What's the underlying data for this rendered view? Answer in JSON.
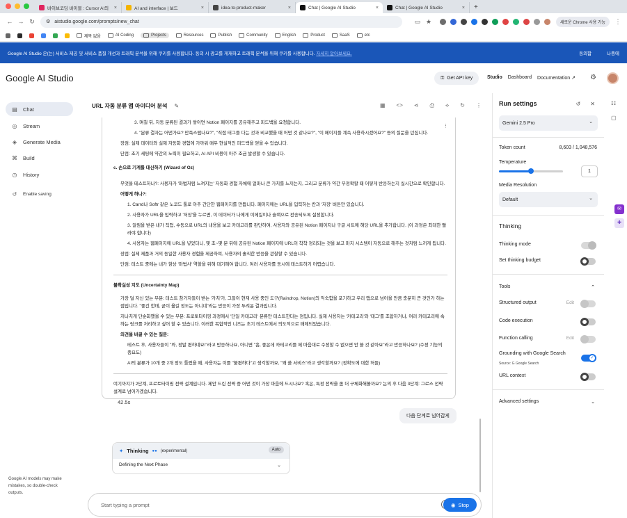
{
  "browser": {
    "tabs": [
      {
        "title": "바이브코딩 바이블 : Cursor AI의",
        "color": "#e0245e"
      },
      {
        "title": "AI and interface | 보드",
        "color": "#f4b400"
      },
      {
        "title": "idea-to-product-maker",
        "color": "#444444"
      },
      {
        "title": "Chat | Google AI Studio",
        "color": "#111111"
      },
      {
        "title": "Chat | Google AI Studio",
        "color": "#111111"
      }
    ],
    "url": "aistudio.google.com/prompts/new_chat",
    "chrome_button": "새로운 Chrome 사용 가능",
    "bookmarks": [
      "제목 없음",
      "AI Coding",
      "Projects",
      "Resources",
      "Publish",
      "Community",
      "English",
      "Product",
      "SaaS",
      "etc"
    ]
  },
  "cookie": {
    "message": "Google AI Studio 은(는) 서비스 제공 및 서비스 품질 개선과 트래픽 분석을 위해 쿠키를 사용합니다. 동의 시 광고를 게재하고 트래픽 분석을 위해 쿠키를 사용합니다.",
    "link": "자세히 알아보세요.",
    "agree": "동의함",
    "later": "나중에"
  },
  "header": {
    "brand": "Google AI Studio",
    "api_key": "Get API key",
    "nav": [
      "Studio",
      "Dashboard",
      "Documentation"
    ]
  },
  "sidebar": {
    "items": [
      "Chat",
      "Stream",
      "Generate Media",
      "Build",
      "History"
    ],
    "enable_saving": "Enable saving",
    "footer": "Google AI models may make mistakes, so double-check outputs."
  },
  "chat": {
    "title": "URL 자동 분류 앱 아이디어 분석",
    "lines": [
      "3. 며칠 뒤, 자동 분류된 결과가 쌓이면 Notion 페이지를 공유해주고 피드백을 요청합니다.",
      "4. \"분류 결과는 어떤가요? 만족스럽나요?\", \"직접 태그를 다는 것과 비교했을 때 어떤 것 같나요?\", \"이 페이지를 계속 사용하시겠어요?\" 등의 질문을 던집니다.",
      "장점: 실제 데이터와 실제 자동화 경험에 가까워 매우 현실적인 피드백을 얻을 수 있습니다.",
      "단점: 초기 세팅에 약간의 노력이 필요하고, AI API 비용이 아주 조금 발생할 수 있습니다.",
      "c. 손으로 기계를 대신하기 (Wizard of Oz)",
      "무엇을 테스트하나?: 사용자가 '마법처럼 느껴지는' 자동화 경험 자체에 얼마나 큰 가치를 느끼는지, 그리고 분류가 약간 부정확할 때 어떻게 반응하는지 실시간으로 확인합니다.",
      "어떻게 하나?:",
      "1. Carrd나 Softr 같은 노코드 툴로 아주 간단한 웹페이지를 만듭니다. 페이지에는 URL을 입력하는 칸과 '저장' 버튼만 있습니다.",
      "2. 사용자가 URL을 입력하고 '저장'을 누르면, 이 데이터가 나에게 이메일이나 슬랙으로 전송되도록 설정합니다.",
      "3. 알림을 받은 내가 직접, 수동으로 URL의 내용을 보고 카테고리를 판단하여, 사용자와 공유된 Notion 페이지나 구글 시트에 해당 URL을 추가합니다. (이 과정은 최대한 빨라야 합니다)",
      "4. 사용자는 웹페이지에 URL을 넣었더니, 몇 초~몇 분 뒤에 공유된 Notion 페이지에 URL이 착착 정리되는 것을 보고 마치 시스템이 자동으로 해주는 것처럼 느끼게 됩니다.",
      "장점: 실제 제품과 거의 동일한 사용자 경험을 제공하며, 사용자의 솔직한 반응을 관찰할 수 있습니다.",
      "단점: 테스트 중에는 내가 항상 '마법사' 역할을 위해 대기해야 합니다. 여러 사용자를 동시에 테스트하기 어렵습니다.",
      "불확실성 지도 (Uncertainty Map)",
      "가장 덜 자신 있는 부분: 테스트 참가자들이 받는 '가치'가, 그들이 현재 사용 중인 도구(Raindrop, Notion)의 익숙함을 포기하고 우리 앱으로 넘어올 만큼 충분히 큰 것인가 하는 점입니다. \"좋긴 한데, 굳이 옮길 정도는 아니네\"라는 반응이 가장 두려운 결과입니다.",
      "지나치게 단순화했을 수 있는 부분: 프로토타이핑 과정에서 '단일 카테고리' 분류만 테스트한다는 점입니다. 실제 사용자는 '카테고리'와 '태그'를 조합하거나, 여러 카테고리에 속하는 링크를 처리하고 싶어 할 수 있습니다. 이러한 복합적인 니즈는 초기 테스트에서 의도적으로 배제되었습니다.",
      "의견을 바꿀 수 있는 질문:",
      "테스트 후, 사용자들이 \"와, 정말 편하네요!\"라고 반응하나요, 아니면 \"흠, 좋은데 카테고리를 제 마음대로 수정할 수 없으면 안 쓸 것 같아요\"라고 반응하나요? (수정 기능의 중요도)",
      "AI의 분류가 10개 중 2개 정도 틀렸을 때, 사용자는 이를 \"불편하다\"고 생각할까요, \"꽤 쓸 서비스\"라고 생각할까요? (정확도에 대한 허들)",
      "여기까지가 2단계, 프로토타이핑 전략 설계입니다. 제안 드린 전략 중 어떤 것이 가장 마음에 드시나요? 혹은, 특정 전략을 좀 더 구체화해볼까요? 논의 후 다음 3단계: 그로스 전략 설계로 넘어가겠습니다."
    ],
    "time": "42.5s",
    "user_message": "다음 단계로 넘어갑게",
    "thinking_label": "Thinking",
    "thinking_tag": "(experimental)",
    "thinking_mode": "Auto",
    "thinking_status": "Defining the Next Phase",
    "prompt_placeholder": "Start typing a prompt",
    "stop": "Stop"
  },
  "run_settings": {
    "title": "Run settings",
    "model": "Gemini 2.5 Pro",
    "token_label": "Token count",
    "token_value": "8,603 / 1,048,576",
    "temperature_label": "Temperature",
    "temperature": "1",
    "temperature_fraction": 0.5,
    "media_label": "Media Resolution",
    "media_value": "Default",
    "thinking_title": "Thinking",
    "thinking_mode": "Thinking mode",
    "thinking_budget": "Set thinking budget",
    "tools_title": "Tools",
    "structured": "Structured output",
    "code_exec": "Code execution",
    "function_calling": "Function calling",
    "edit": "Edit",
    "grounding": "Grounding with Google Search",
    "source": "Source:",
    "google_search": "Google Search",
    "url_context": "URL context",
    "advanced": "Advanced settings"
  }
}
